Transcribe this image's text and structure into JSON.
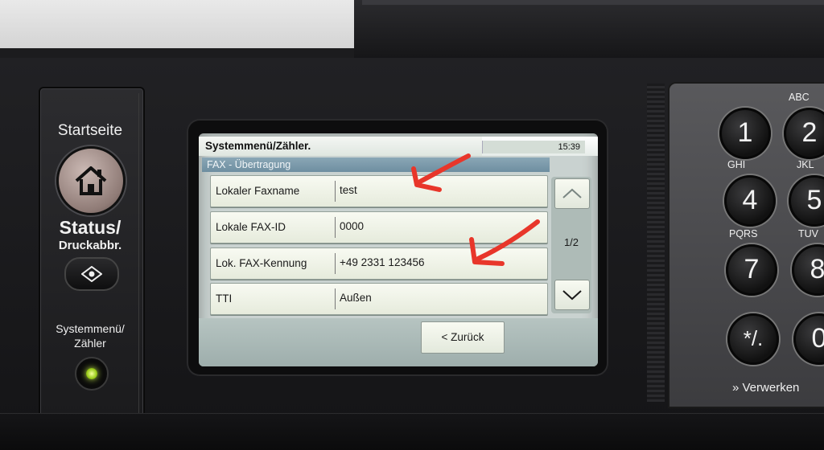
{
  "left_panel": {
    "home_label": "Startseite",
    "status_label": "Status/",
    "status_sub_label": "Druckabbr.",
    "system_label_line1": "Systemmenü/",
    "system_label_line2": "Zähler"
  },
  "screen": {
    "title": "Systemmenü/Zähler.",
    "time": "15:39",
    "subheader": "FAX - Übertragung",
    "rows": [
      {
        "label": "Lokaler Faxname",
        "value": "test"
      },
      {
        "label": "Lokale FAX-ID",
        "value": "0000"
      },
      {
        "label": "Lok. FAX-Kennung",
        "value": "+49 2331 123456"
      },
      {
        "label": "TTI",
        "value": "Außen"
      }
    ],
    "page_indicator": "1/2",
    "back_button": "< Zurück"
  },
  "keypad": {
    "keys": [
      {
        "digit": "1",
        "letters": ""
      },
      {
        "digit": "2",
        "letters": "ABC"
      },
      {
        "digit": "4",
        "letters": "GHI"
      },
      {
        "digit": "5",
        "letters": "JKL"
      },
      {
        "digit": "7",
        "letters": "PQRS"
      },
      {
        "digit": "8",
        "letters": "TUV"
      },
      {
        "digit": "*/.",
        "letters": ""
      },
      {
        "digit": "0",
        "letters": ""
      }
    ],
    "process_label": "» Verwerken"
  },
  "colors": {
    "annotation_red": "#e8362a",
    "screen_row_bg": "#f3f6ec",
    "subheader_bg": "#7d9aab"
  }
}
